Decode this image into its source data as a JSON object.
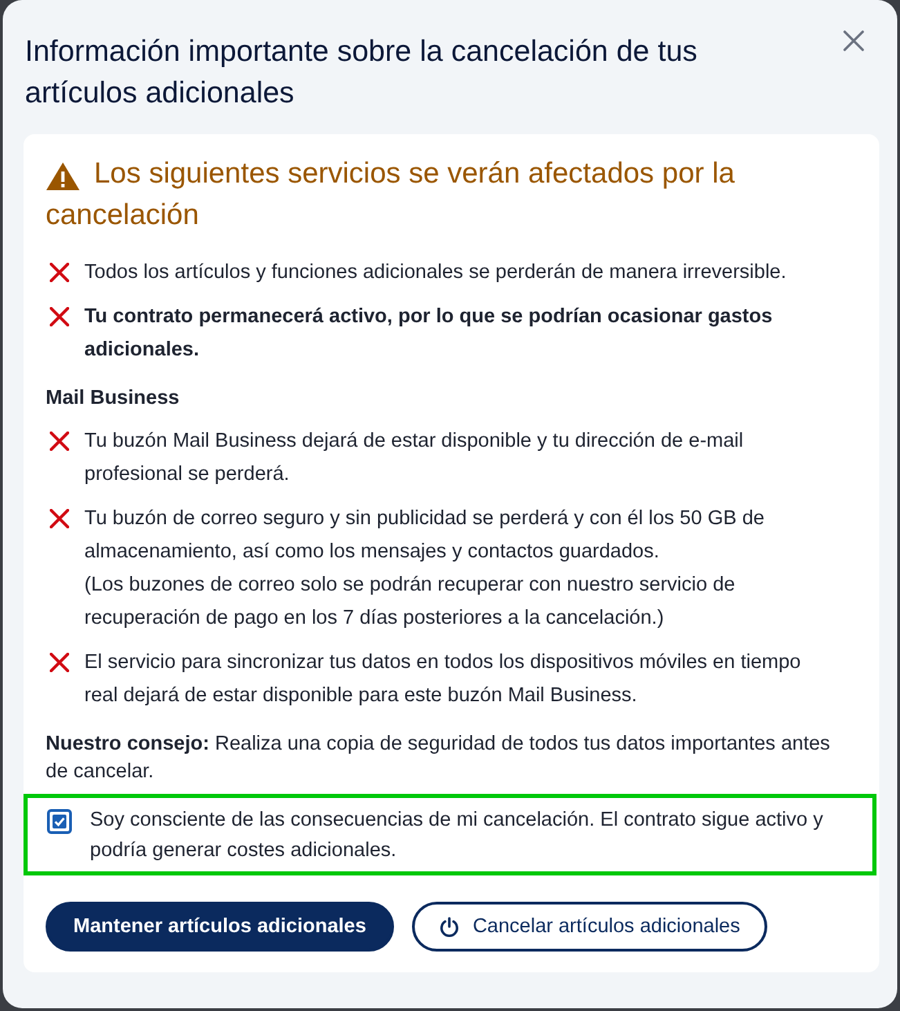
{
  "dialog": {
    "title": "Información importante sobre la cancelación de tus artículos adicionales"
  },
  "warning": {
    "heading": "Los siguientes servicios se verán afectados por la cancelación"
  },
  "sections": [
    {
      "items": [
        {
          "text": "Todos los artículos y funciones adicionales se perderán de manera irreversible.",
          "emphasis": false
        },
        {
          "text": "Tu contrato permanecerá activo, por lo que se podrían ocasionar gastos adicionales.",
          "emphasis": true
        }
      ]
    },
    {
      "title": "Mail Business",
      "items": [
        {
          "text": "Tu buzón Mail Business dejará de estar disponible y tu dirección de e-mail profesional se perderá.",
          "emphasis": false
        },
        {
          "text": "Tu buzón de correo seguro y sin publicidad se perderá y con él los 50 GB de almacenamiento, así como los mensajes y contactos guardados.",
          "note": "(Los buzones de correo solo se podrán recuperar con nuestro servicio de recuperación de pago en los 7 días posteriores a la cancelación.)",
          "emphasis": false
        },
        {
          "text": "El servicio para sincronizar tus datos en todos los dispositivos móviles en tiempo real dejará de estar disponible para este buzón Mail Business.",
          "emphasis": false
        }
      ]
    }
  ],
  "advice": "**Nuestro consejo:** Realiza una copia de seguridad de todos tus datos importantes antes de cancelar.",
  "consent": {
    "label": "Soy consciente de las consecuencias de mi cancelación. El contrato sigue activo y podría generar costes adicionales.",
    "checked": true,
    "focused": true
  },
  "buttons": [
    {
      "label": "Mantener artículos adicionales",
      "kind": "primary"
    },
    {
      "label": "Cancelar artículos adicionales",
      "kind": "secondary"
    }
  ]
}
